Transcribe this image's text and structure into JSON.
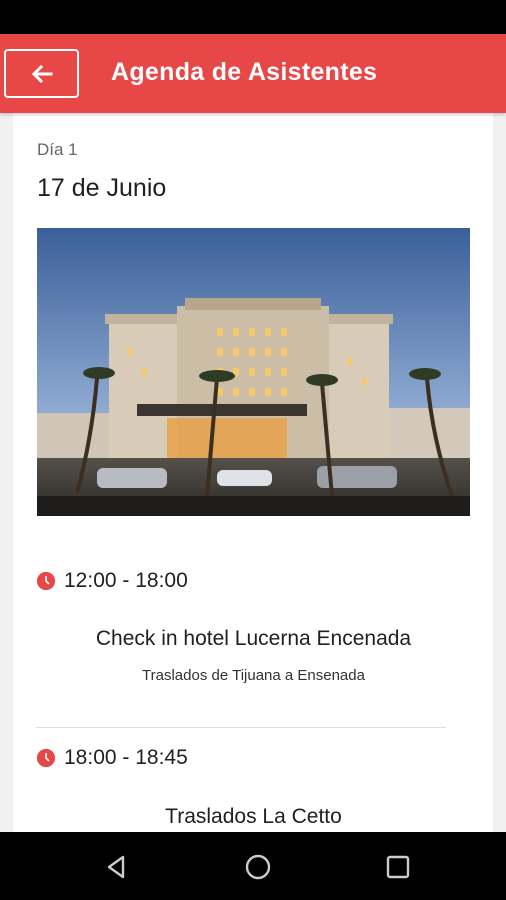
{
  "header": {
    "title": "Agenda de Asistentes",
    "back_icon": "arrow-left-icon",
    "color": "#e84747"
  },
  "day": {
    "label": "Día 1",
    "date": "17 de Junio",
    "image": "hotel-photo"
  },
  "events": [
    {
      "time": "12:00 - 18:00",
      "title": "Check in hotel Lucerna Encenada",
      "subtitle": "Traslados de Tijuana a Ensenada"
    },
    {
      "time": "18:00 - 18:45",
      "title": "Traslados La Cetto",
      "subtitle": ""
    }
  ],
  "navigation": {
    "back": "triangle-back-icon",
    "home": "circle-home-icon",
    "recents": "square-recents-icon"
  }
}
